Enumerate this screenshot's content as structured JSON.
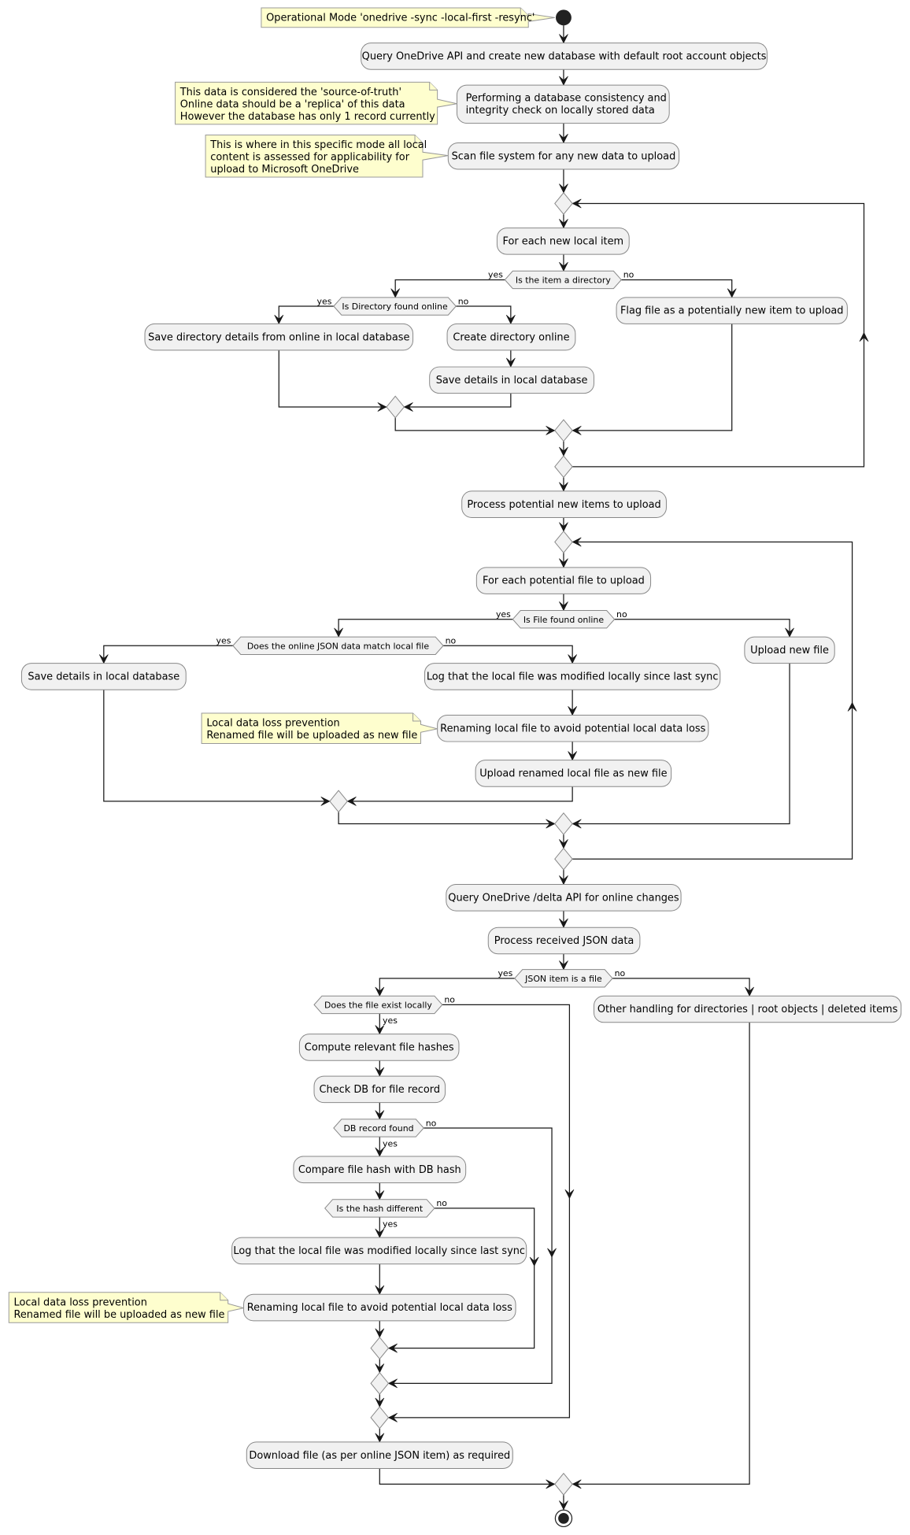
{
  "diagram": {
    "type": "activity",
    "notes": {
      "mode": "Operational Mode 'onedrive -sync -local-first -resync'",
      "source_of_truth": [
        "This data is considered the 'source-of-truth'",
        "Online data should be a 'replica' of this data",
        "However the database has only 1 record currently"
      ],
      "scan_scope": [
        "This is where in this specific mode all local",
        " content is assessed for applicability for",
        "upload to Microsoft OneDrive"
      ],
      "data_loss_1": [
        "Local data loss prevention",
        "Renamed file will be uploaded as new file"
      ],
      "data_loss_2": [
        "Local data loss prevention",
        "Renamed file will be uploaded as new file"
      ]
    },
    "actions": {
      "query_api": "Query OneDrive API and create new database with default root account objects",
      "consistency_check": [
        "Performing a database consistency and",
        "integrity check on locally stored data"
      ],
      "scan_fs": "Scan file system for any new data to upload",
      "for_each_local": "For each new local item",
      "save_dir_details": "Save directory details from online in local database",
      "create_dir": "Create directory online",
      "save_details_1": "Save details in local database",
      "flag_file": "Flag file as a potentially new item to upload",
      "process_potential": "Process potential new items to upload",
      "for_each_potential": "For each potential file to upload",
      "save_details_2": "Save details in local database",
      "log_modified_1": "Log that the local file was modified locally since last sync",
      "rename_1": "Renaming local file to avoid potential local data loss",
      "upload_renamed": "Upload renamed local file as new file",
      "upload_new": "Upload new file",
      "query_delta": "Query OneDrive /delta API for online changes",
      "process_json": "Process received JSON data",
      "other_handling": "Other handling for directories | root objects | deleted items",
      "compute_hashes": "Compute relevant file hashes",
      "check_db": "Check DB for file record",
      "compare_hash": "Compare file hash with DB hash",
      "log_modified_2": "Log that the local file was modified locally since last sync",
      "rename_2": "Renaming local file to avoid potential local data loss",
      "download": "Download file (as per online JSON item) as required"
    },
    "decisions": {
      "is_directory": "Is the item a directory",
      "dir_found_online": "Is Directory found online",
      "file_found_online": "Is File found online",
      "json_match": "Does the online JSON data match local file",
      "json_is_file": "JSON item is a file",
      "file_exists_locally": "Does the file exist locally",
      "db_record_found": "DB record found",
      "hash_different": "Is the hash different"
    },
    "labels": {
      "yes": "yes",
      "no": "no"
    }
  }
}
